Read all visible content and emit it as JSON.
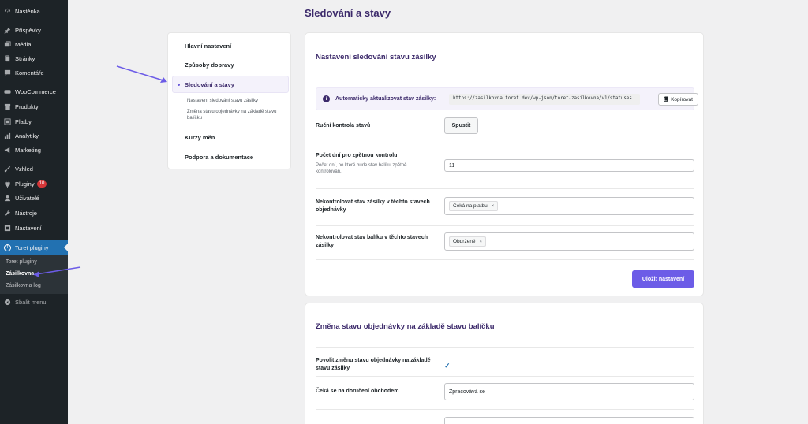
{
  "sidebar": {
    "items": [
      {
        "label": "Nástěnka",
        "icon": "dashboard-icon"
      },
      {
        "label": "Příspěvky",
        "icon": "pin-icon"
      },
      {
        "label": "Média",
        "icon": "media-icon"
      },
      {
        "label": "Stránky",
        "icon": "page-icon"
      },
      {
        "label": "Komentáře",
        "icon": "comment-icon"
      },
      {
        "label": "WooCommerce",
        "icon": "woo-icon"
      },
      {
        "label": "Produkty",
        "icon": "archive-icon"
      },
      {
        "label": "Platby",
        "icon": "payment-icon"
      },
      {
        "label": "Analytiky",
        "icon": "bar-chart-icon"
      },
      {
        "label": "Marketing",
        "icon": "megaphone-icon"
      },
      {
        "label": "Vzhled",
        "icon": "brush-icon"
      },
      {
        "label": "Pluginy",
        "icon": "plugin-icon",
        "badge": "10"
      },
      {
        "label": "Uživatelé",
        "icon": "user-icon"
      },
      {
        "label": "Nástroje",
        "icon": "wrench-icon"
      },
      {
        "label": "Nastavení",
        "icon": "settings-icon"
      },
      {
        "label": "Toret pluginy",
        "icon": "toret-icon",
        "icon_letter": "T"
      }
    ],
    "submenu": [
      "Toret pluginy",
      "Zásilkovna",
      "Zásilkovna log"
    ],
    "collapse_label": "Sbalit menu"
  },
  "page": {
    "title": "Sledování a stavy"
  },
  "nav": {
    "items": [
      "Hlavní nastavení",
      "Způsoby dopravy",
      "Sledování a stavy",
      "Kurzy měn",
      "Podpora a dokumentace"
    ],
    "subitems": [
      "Nastavení sledování stavu zásilky",
      "Změna stavu objednávky na základě stavu balíčku"
    ]
  },
  "tracking": {
    "title": "Nastavení sledování stavu zásilky",
    "auto_label": "Automaticky aktualizovat stav zásilky:",
    "url": "https://zasilkovna.toret.dev/wp-json/toret-zasilkovna/v1/statuses",
    "copy_label": "Kopírovat",
    "manual_label": "Ruční kontrola stavů",
    "run_label": "Spustit",
    "days_label": "Počet dní pro zpětnou kontrolu",
    "days_help": "Počet dní, po které bude stav balíku zpětně kontrolován.",
    "days_value": "11",
    "exclude_order_label": "Nekontrolovat stav zásilky v těchto stavech objednávky",
    "exclude_order_tag": "Čeká na platbu",
    "exclude_pkg_label": "Nekontrolovat stav balíku v těchto stavech zásilky",
    "exclude_pkg_tag": "Obdržené",
    "tag_remove": "×",
    "save_label": "Uložit nastavení"
  },
  "order_status": {
    "title": "Změna stavu objednávky na základě stavu balíčku",
    "allow_label": "Povolit změnu stavu objednávky na základě stavu zásilky",
    "check_mark": "✓",
    "waiting_label": "Čeká se na doručení obchodem",
    "waiting_value": "Zpracovává se"
  },
  "colors": {
    "accent": "#6c5ce7",
    "title": "#3c2a6b",
    "sidebar": "#1d2327",
    "active": "#2271b1",
    "arrow": "#6c5ce7"
  }
}
